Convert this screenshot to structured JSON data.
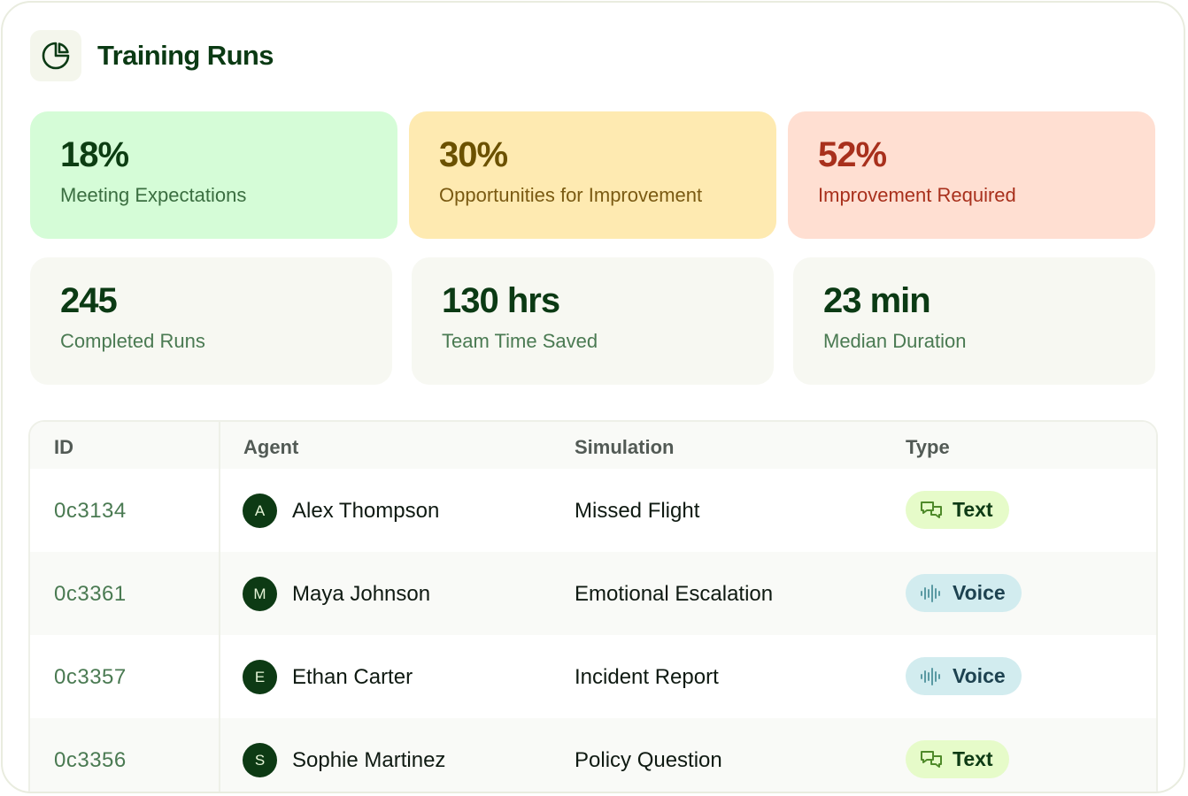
{
  "header": {
    "title": "Training Runs",
    "icon": "pie-chart-icon"
  },
  "score_cards": [
    {
      "value": "18%",
      "label": "Meeting Expectations",
      "color": "#d5fcd7"
    },
    {
      "value": "30%",
      "label": "Opportunities for Improvement",
      "color": "#feeab1"
    },
    {
      "value": "52%",
      "label": "Improvement Required",
      "color": "#ffdfd2"
    }
  ],
  "metric_cards": [
    {
      "value": "245",
      "label": "Completed Runs"
    },
    {
      "value": "130 hrs",
      "label": "Team Time Saved"
    },
    {
      "value": "23 min",
      "label": "Median Duration"
    }
  ],
  "table": {
    "columns": [
      "ID",
      "Agent",
      "Simulation",
      "Type"
    ],
    "rows": [
      {
        "id": "0c3134",
        "initial": "A",
        "agent": "Alex Thompson",
        "simulation": "Missed Flight",
        "type": "Text",
        "type_icon": "chat-icon"
      },
      {
        "id": "0c3361",
        "initial": "M",
        "agent": "Maya Johnson",
        "simulation": "Emotional Escalation",
        "type": "Voice",
        "type_icon": "waveform-icon"
      },
      {
        "id": "0c3357",
        "initial": "E",
        "agent": "Ethan Carter",
        "simulation": "Incident Report",
        "type": "Voice",
        "type_icon": "waveform-icon"
      },
      {
        "id": "0c3356",
        "initial": "S",
        "agent": "Sophie Martinez",
        "simulation": "Policy Question",
        "type": "Text",
        "type_icon": "chat-icon"
      }
    ]
  }
}
